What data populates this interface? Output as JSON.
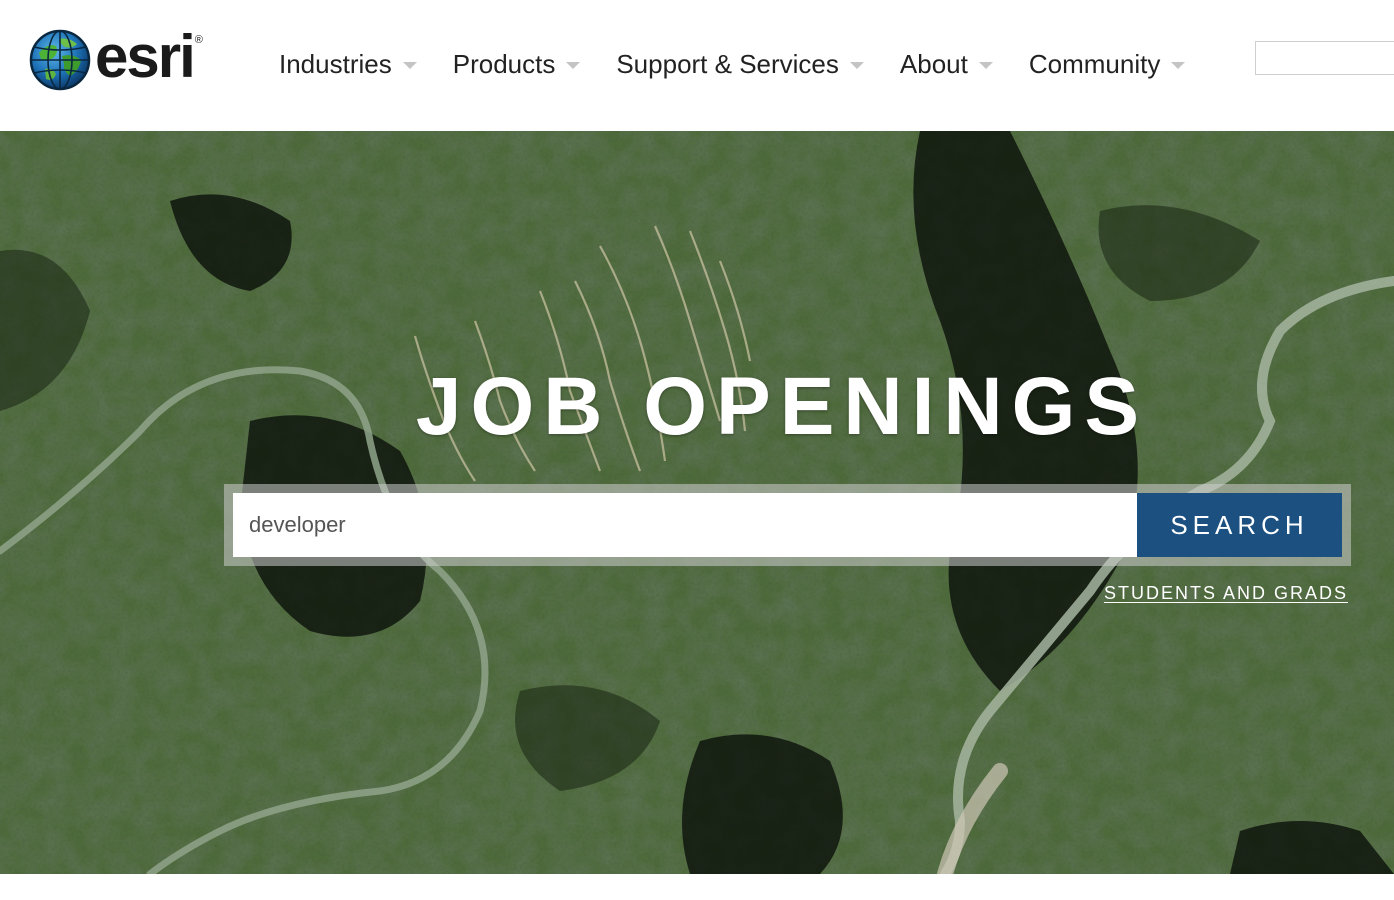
{
  "header": {
    "logo": {
      "name": "esri",
      "icon": "globe-icon",
      "registered_mark": "®"
    },
    "nav": [
      {
        "label": "Industries"
      },
      {
        "label": "Products"
      },
      {
        "label": "Support & Services"
      },
      {
        "label": "About"
      },
      {
        "label": "Community"
      }
    ],
    "search": {
      "value": ""
    }
  },
  "hero": {
    "title": "JOB OPENINGS",
    "search": {
      "value": "developer",
      "button_label": "SEARCH"
    },
    "students_link": "STUDENTS AND GRADS"
  },
  "colors": {
    "search_button": "#1b5080",
    "nav_text": "#222222",
    "caret": "#c4c4c4"
  }
}
